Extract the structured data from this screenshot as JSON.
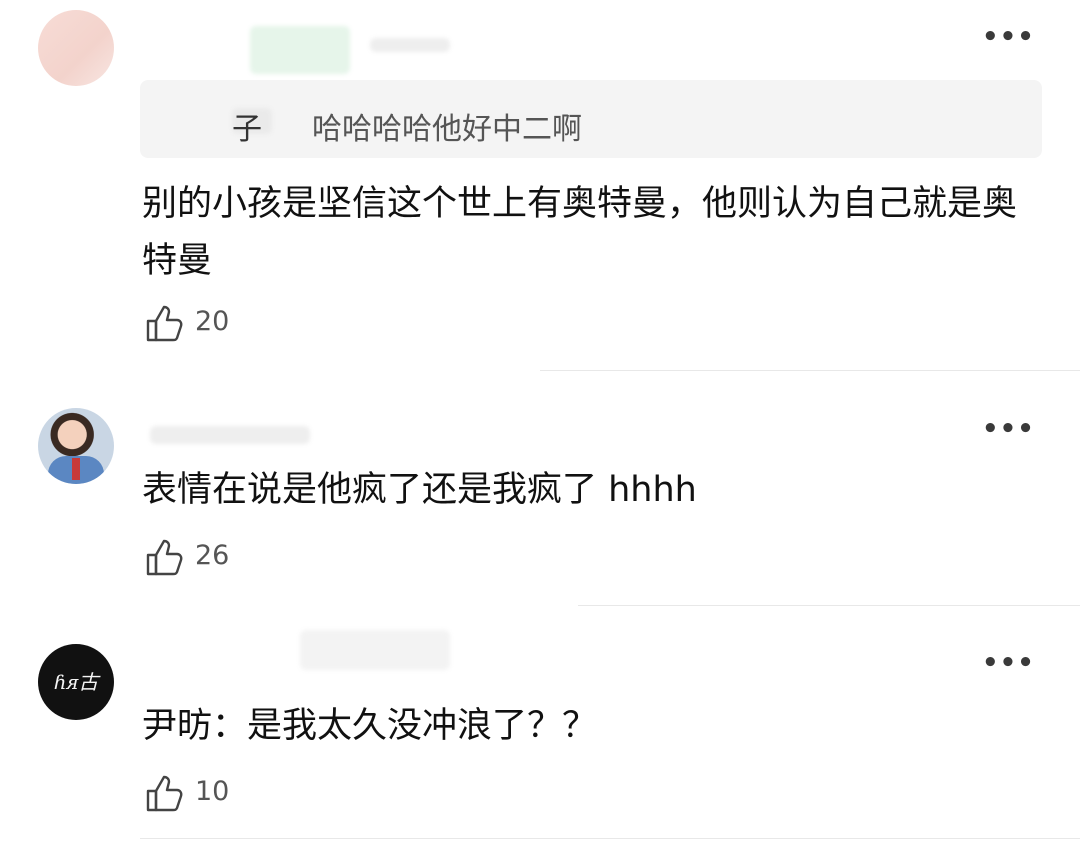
{
  "comments": [
    {
      "reply_to_name": "子",
      "reply_to_text": "哈哈哈哈他好中二啊",
      "text": "别的小孩是坚信这个世上有奥特曼，他则认为自己就是奥特曼",
      "likes": "20",
      "more_icon": "more-horizontal-icon",
      "like_icon": "thumbs-up-icon"
    },
    {
      "text": "表情在说是他疯了还是我疯了 hhhh",
      "likes": "26",
      "more_icon": "more-horizontal-icon",
      "like_icon": "thumbs-up-icon"
    },
    {
      "text": "尹昉：是我太久没冲浪了？？",
      "likes": "10",
      "more_icon": "more-horizontal-icon",
      "like_icon": "thumbs-up-icon"
    }
  ],
  "ui": {
    "more_glyph": "•••"
  },
  "colors": {
    "text": "#111111",
    "muted": "#555555",
    "quote_bg": "#f4f4f4",
    "divider": "#e8e8e8"
  }
}
